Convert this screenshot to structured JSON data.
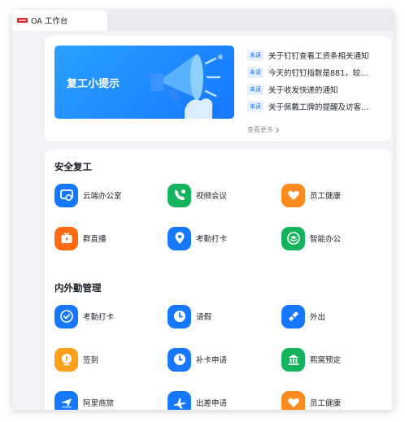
{
  "tab": {
    "title": "OA 工作台",
    "logo_icon": "brand-logo-icon"
  },
  "banner": {
    "text": "复工小提示",
    "icon": "megaphone-icon"
  },
  "notices": {
    "badge_label": "未读",
    "items": [
      {
        "text": "关于钉钉查看工资条相关通知"
      },
      {
        "text": "今天的钉钉指数是881，较…"
      },
      {
        "text": "关于收发快递的通知"
      },
      {
        "text": "关于佩戴工牌的提醒及访客…"
      }
    ],
    "more_label": "查看更多"
  },
  "sections": [
    {
      "title": "安全复工",
      "apps": [
        {
          "label": "云端办公室",
          "icon": "cloud-office-icon",
          "color": "#1677ff"
        },
        {
          "label": "视频会议",
          "icon": "video-call-icon",
          "color": "#16b35e"
        },
        {
          "label": "员工健康",
          "icon": "heart-icon",
          "color": "#ff8a1f"
        },
        {
          "label": "群直播",
          "icon": "live-tv-icon",
          "color": "#ff6a13"
        },
        {
          "label": "考勤打卡",
          "icon": "location-pin-icon",
          "color": "#1677ff"
        },
        {
          "label": "智能办公",
          "icon": "layers-icon",
          "color": "#16b35e"
        }
      ]
    },
    {
      "title": "内外勤管理",
      "apps": [
        {
          "label": "考勤打卡",
          "icon": "location-pin-icon",
          "color": "#1677ff"
        },
        {
          "label": "请假",
          "icon": "clock-icon",
          "color": "#1677ff"
        },
        {
          "label": "外出",
          "icon": "pennant-icon",
          "color": "#1677ff"
        },
        {
          "label": "签到",
          "icon": "location-pin-icon",
          "color": "#ff9f1a"
        },
        {
          "label": "补卡申请",
          "icon": "clock-icon",
          "color": "#1677ff"
        },
        {
          "label": "熙窝预定",
          "icon": "building-icon",
          "color": "#16b35e"
        },
        {
          "label": "阿里商旅",
          "icon": "travel-icon",
          "color": "#1677ff"
        },
        {
          "label": "出差申请",
          "icon": "airplane-icon",
          "color": "#1677ff"
        },
        {
          "label": "员工健康",
          "icon": "heart-icon",
          "color": "#ff8a1f"
        }
      ]
    }
  ]
}
